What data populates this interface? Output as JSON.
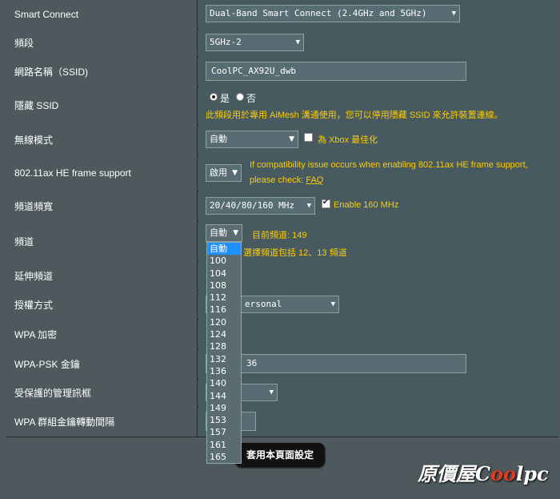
{
  "rows": {
    "smart_connect": {
      "label": "Smart Connect",
      "value": "Dual-Band Smart Connect (2.4GHz and 5GHz)"
    },
    "band": {
      "label": "頻段",
      "value": "5GHz-2"
    },
    "ssid": {
      "label": "網路名稱（SSID)",
      "value": "CoolPC_AX92U_dwb"
    },
    "hide_ssid": {
      "label": "隱藏 SSID",
      "yes": "是",
      "no": "否",
      "selected": "yes",
      "note": "此頻段用於專用 AiMesh 溝通使用，您可以停用隱藏 SSID 來允許裝置連線。"
    },
    "wireless_mode": {
      "label": "無線模式",
      "value": "自動",
      "xbox_label": "為 Xbox 最佳化",
      "xbox_checked": false
    },
    "he_frame": {
      "label": "802.11ax HE frame support",
      "value": "啟用",
      "note_line1": "If compatibility issue occurs when enabling 802.11ax HE frame support,",
      "note_prefix": "please check: ",
      "faq": "FAQ"
    },
    "bandwidth": {
      "label": "頻道頻寬",
      "value": "20/40/80/160 MHz",
      "enable160": "Enable 160 MHz",
      "enable160_checked": true
    },
    "channel": {
      "label": "頻道",
      "value": "自動",
      "current": "目前頻道: 149",
      "note": "選擇頻道包括 12、13 頻道"
    },
    "ext_channel": {
      "label": "延伸頻道"
    },
    "auth": {
      "label": "授權方式",
      "value": "ersonal"
    },
    "wpa_enc": {
      "label": "WPA 加密"
    },
    "psk": {
      "label": "WPA-PSK 金鑰",
      "value": "36"
    },
    "pmf": {
      "label": "受保護的管理訊框"
    },
    "rekey": {
      "label": "WPA 群組金鑰轉動間隔"
    }
  },
  "channel_options": [
    "自動",
    "100",
    "104",
    "108",
    "112",
    "116",
    "120",
    "124",
    "128",
    "132",
    "136",
    "140",
    "144",
    "149",
    "153",
    "157",
    "161",
    "165"
  ],
  "apply_label": "套用本頁面設定",
  "watermark": {
    "prefix": "原價屋C",
    "oo": "oo",
    "suffix": "lpc"
  }
}
